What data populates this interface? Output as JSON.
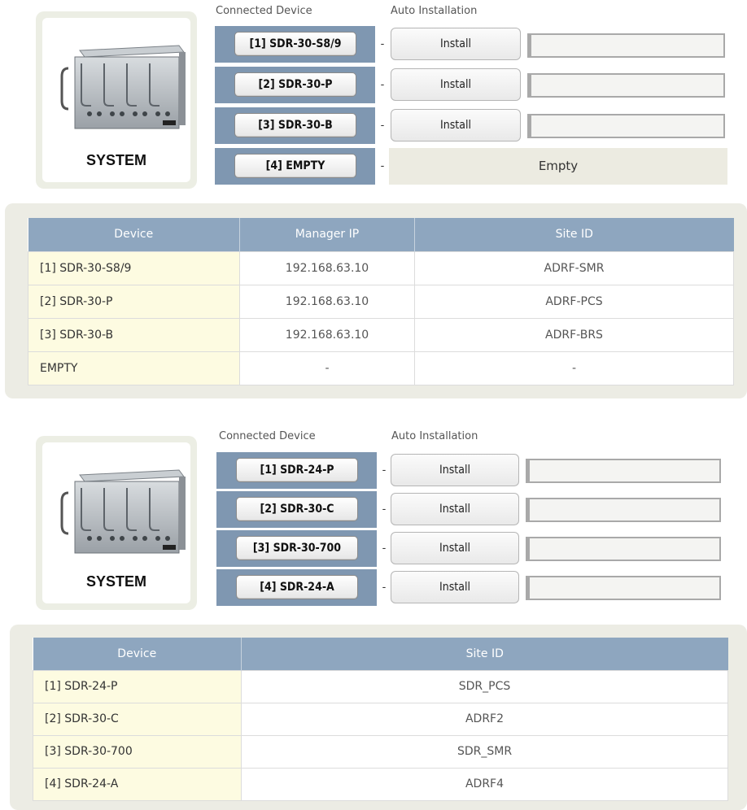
{
  "system1": {
    "label": "SYSTEM",
    "connected_device_heading": "Connected Device",
    "auto_installation_heading": "Auto Installation",
    "devices": [
      {
        "name": "[1] SDR-30-S8/9",
        "install": "Install"
      },
      {
        "name": "[2] SDR-30-P",
        "install": "Install"
      },
      {
        "name": "[3] SDR-30-B",
        "install": "Install"
      },
      {
        "name": "[4] EMPTY",
        "status": "Empty"
      }
    ],
    "dash": "-"
  },
  "table1": {
    "headers": [
      "Device",
      "Manager IP",
      "Site ID"
    ],
    "rows": [
      [
        "[1] SDR-30-S8/9",
        "192.168.63.10",
        "ADRF-SMR"
      ],
      [
        "[2] SDR-30-P",
        "192.168.63.10",
        "ADRF-PCS"
      ],
      [
        "[3] SDR-30-B",
        "192.168.63.10",
        "ADRF-BRS"
      ],
      [
        "EMPTY",
        "-",
        "-"
      ]
    ]
  },
  "system2": {
    "label": "SYSTEM",
    "connected_device_heading": "Connected Device",
    "auto_installation_heading": "Auto Installation",
    "devices": [
      {
        "name": "[1] SDR-24-P",
        "install": "Install"
      },
      {
        "name": "[2] SDR-30-C",
        "install": "Install"
      },
      {
        "name": "[3] SDR-30-700",
        "install": "Install"
      },
      {
        "name": "[4] SDR-24-A",
        "install": "Install"
      }
    ],
    "dash": "-"
  },
  "table2": {
    "headers": [
      "Device",
      "Site ID"
    ],
    "rows": [
      [
        "[1] SDR-24-P",
        "SDR_PCS"
      ],
      [
        "[2] SDR-30-C",
        "ADRF2"
      ],
      [
        "[3] SDR-30-700",
        "SDR_SMR"
      ],
      [
        "[4] SDR-24-A",
        "ADRF4"
      ]
    ]
  },
  "colors": {
    "device_cell_bg": "#7f97b1",
    "table_header_bg": "#8ea6bf",
    "first_col_bg": "#fdfbe1",
    "panel_bg": "#ecece4"
  },
  "icons": {
    "system_image": "rack-chassis-icon"
  }
}
